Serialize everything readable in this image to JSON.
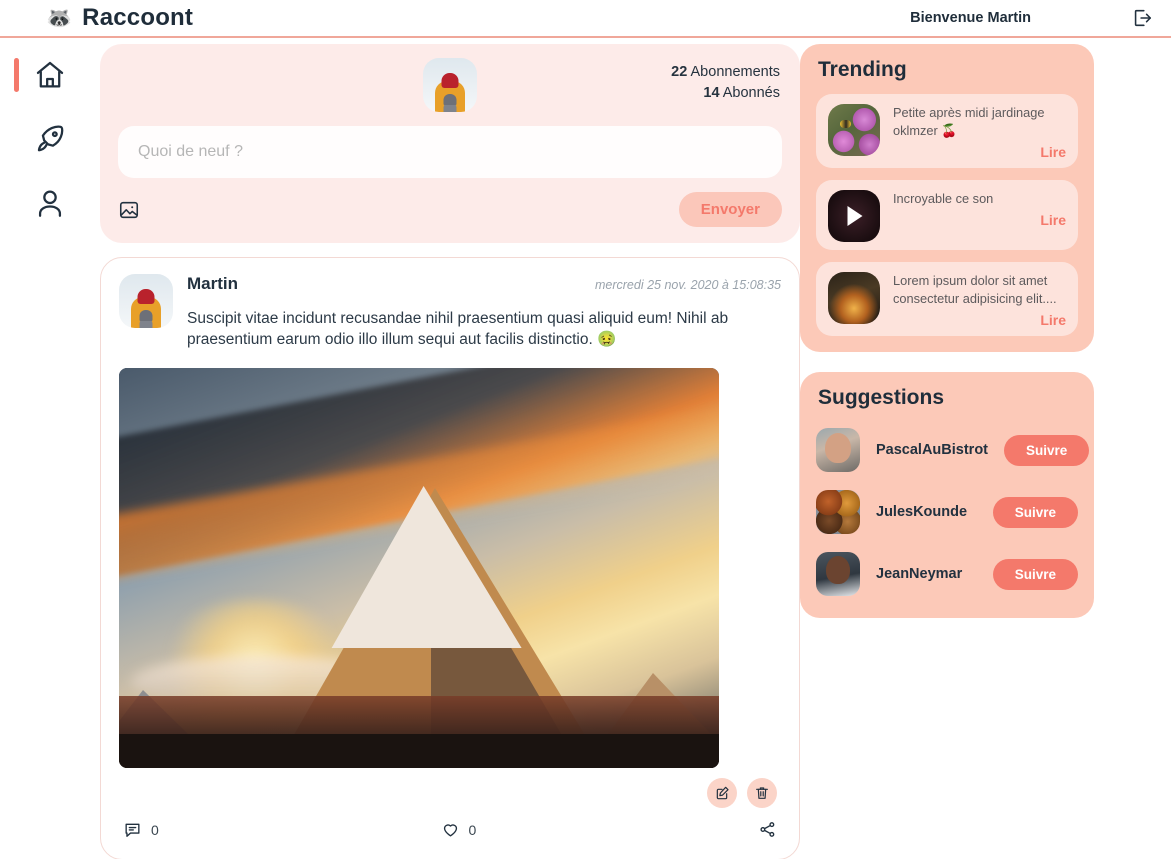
{
  "header": {
    "brand_glyph": "🦝",
    "brand_title": "Raccoont",
    "welcome": "Bienvenue Martin",
    "logout_icon": "logout-icon"
  },
  "sidebar": {
    "items": [
      {
        "name": "home",
        "icon": "home-icon",
        "active": true
      },
      {
        "name": "explore",
        "icon": "rocket-icon",
        "active": false
      },
      {
        "name": "profile",
        "icon": "user-icon",
        "active": false
      }
    ]
  },
  "composer": {
    "avatar_alt": "hiker-avatar",
    "following_count": "22",
    "following_label": "Abonnements",
    "followers_count": "14",
    "followers_label": "Abonnés",
    "placeholder": "Quoi de neuf ?",
    "value": "",
    "image_icon": "image-icon",
    "send_label": "Envoyer"
  },
  "post": {
    "author": "Martin",
    "date": "mercredi 25 nov. 2020 à 15:08:35",
    "text": "Suscipit vitae incidunt recusandae nihil praesentium quasi aliquid eum! Nihil ab praesentium earum odio illo illum sequi aut facilis distinctio. 🤢",
    "image_alt": "sunset-mountain-photo",
    "edit_icon": "edit-icon",
    "delete_icon": "trash-icon",
    "comment_icon": "comment-icon",
    "comment_count": "0",
    "like_icon": "heart-icon",
    "like_count": "0",
    "share_icon": "share-icon"
  },
  "trending": {
    "title": "Trending",
    "items": [
      {
        "thumb": "flowers-thumb",
        "text": "Petite après midi jardinage oklmzer 🍒",
        "read_label": "Lire"
      },
      {
        "thumb": "video-thumb",
        "text": "Incroyable ce son",
        "read_label": "Lire"
      },
      {
        "thumb": "fire-thumb",
        "text": "Lorem ipsum dolor sit amet consectetur adipisicing elit....",
        "read_label": "Lire"
      }
    ]
  },
  "suggestions": {
    "title": "Suggestions",
    "items": [
      {
        "name": "PascalAuBistrot",
        "avatar": "pascal-avatar",
        "follow_label": "Suivre"
      },
      {
        "name": "JulesKounde",
        "avatar": "jules-avatar",
        "follow_label": "Suivre"
      },
      {
        "name": "JeanNeymar",
        "avatar": "neymar-avatar",
        "follow_label": "Suivre"
      }
    ]
  },
  "colors": {
    "accent": "#f4796b",
    "panel_bg": "#fcc9b8",
    "card_bg": "#fde3dc",
    "composer_bg": "#fdebe9",
    "text_dark": "#22313f"
  }
}
